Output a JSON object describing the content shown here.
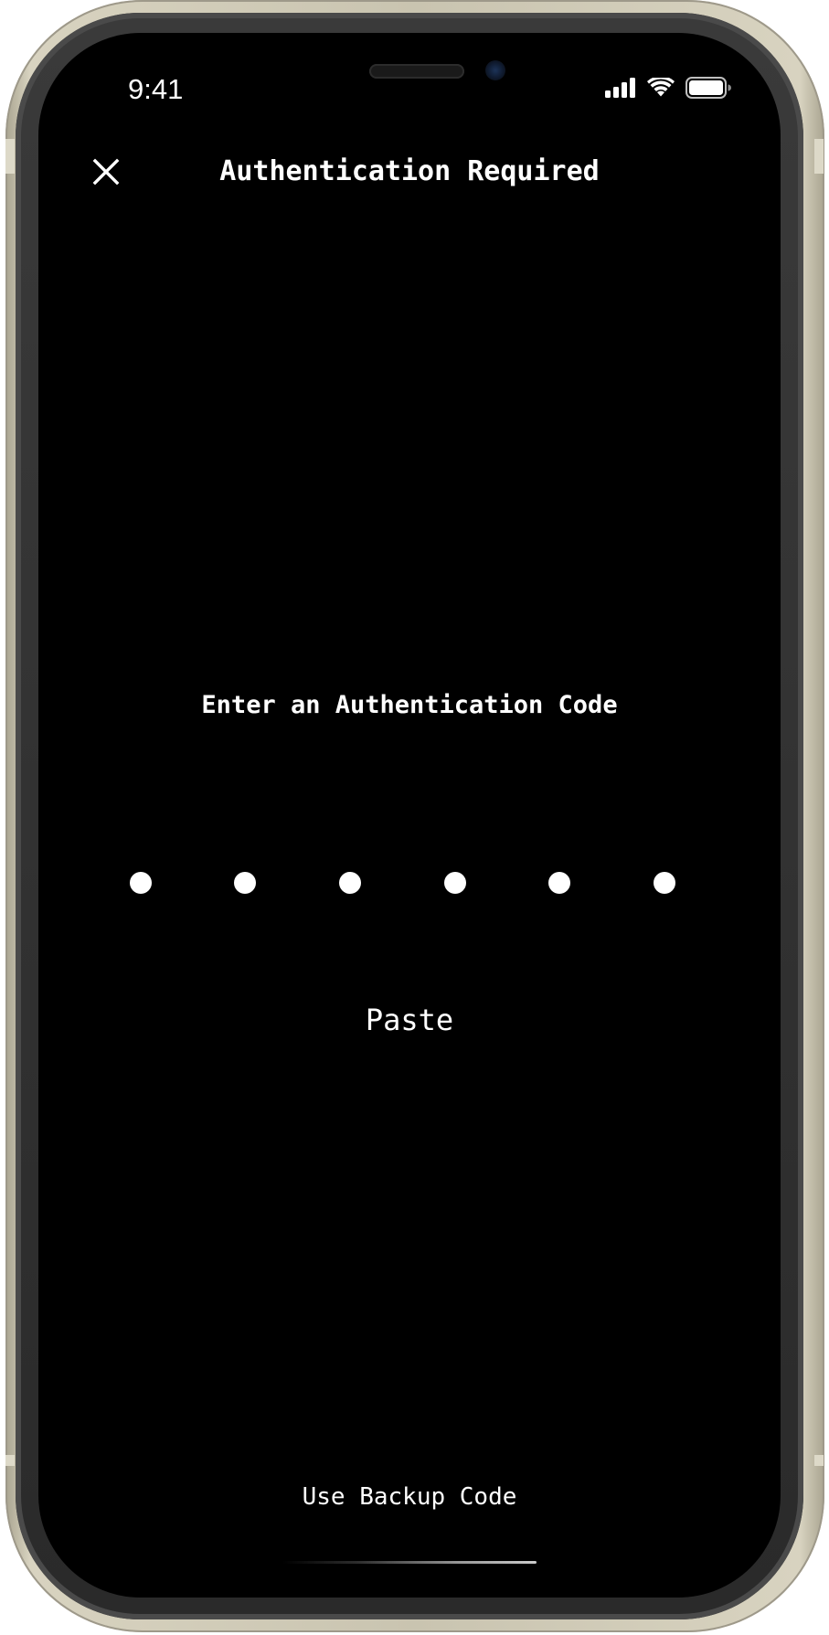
{
  "status_bar": {
    "time": "9:41",
    "icons": [
      "signal-icon",
      "wifi-icon",
      "battery-icon"
    ]
  },
  "nav": {
    "close_icon": "close-icon",
    "title": "Authentication Required"
  },
  "main": {
    "prompt": "Enter an Authentication Code",
    "code_length": 6,
    "code_entered": 0,
    "paste_label": "Paste"
  },
  "footer": {
    "backup_label": "Use Backup Code"
  },
  "colors": {
    "background": "#000000",
    "text": "#ffffff",
    "frame": "#c9c4b0"
  }
}
